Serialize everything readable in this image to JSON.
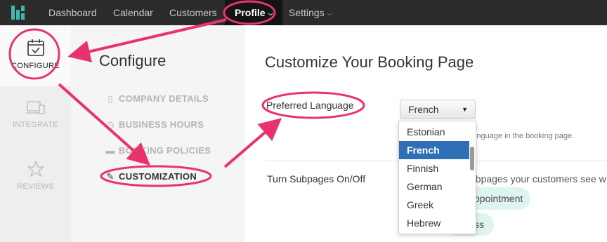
{
  "topnav": {
    "items": [
      {
        "label": "Dashboard"
      },
      {
        "label": "Calendar"
      },
      {
        "label": "Customers"
      },
      {
        "label": "Profile"
      },
      {
        "label": "Settings"
      }
    ]
  },
  "rail": {
    "items": [
      {
        "label": "CONFIGURE",
        "icon": "calendar-check-icon"
      },
      {
        "label": "INTEGRATE",
        "icon": "devices-icon"
      },
      {
        "label": "REVIEWS",
        "icon": "star-icon"
      }
    ]
  },
  "panel": {
    "title": "Configure",
    "items": [
      {
        "label": "COMPANY DETAILS",
        "icon": "building-icon"
      },
      {
        "label": "BUSINESS HOURS",
        "icon": "clock-icon"
      },
      {
        "label": "BOOKING POLICIES",
        "icon": "briefcase-icon"
      },
      {
        "label": "CUSTOMIZATION",
        "icon": "edit-icon"
      }
    ]
  },
  "main": {
    "title": "Customize Your Booking Page",
    "language": {
      "label": "Preferred Language",
      "selected": "French",
      "help": "ault language in the booking page.",
      "options": [
        "Estonian",
        "French",
        "Finnish",
        "German",
        "Greek",
        "Hebrew"
      ]
    },
    "subpages": {
      "label": "Turn Subpages On/Off",
      "text": "ubpages your customers see w",
      "pills": [
        "ppointment",
        "ss"
      ]
    }
  },
  "colors": {
    "accent": "#e8336d",
    "topbar": "#2b2b2b",
    "brand": "#3fb8b0",
    "selected_option": "#2f6fb6",
    "pill": "#def4f1"
  }
}
